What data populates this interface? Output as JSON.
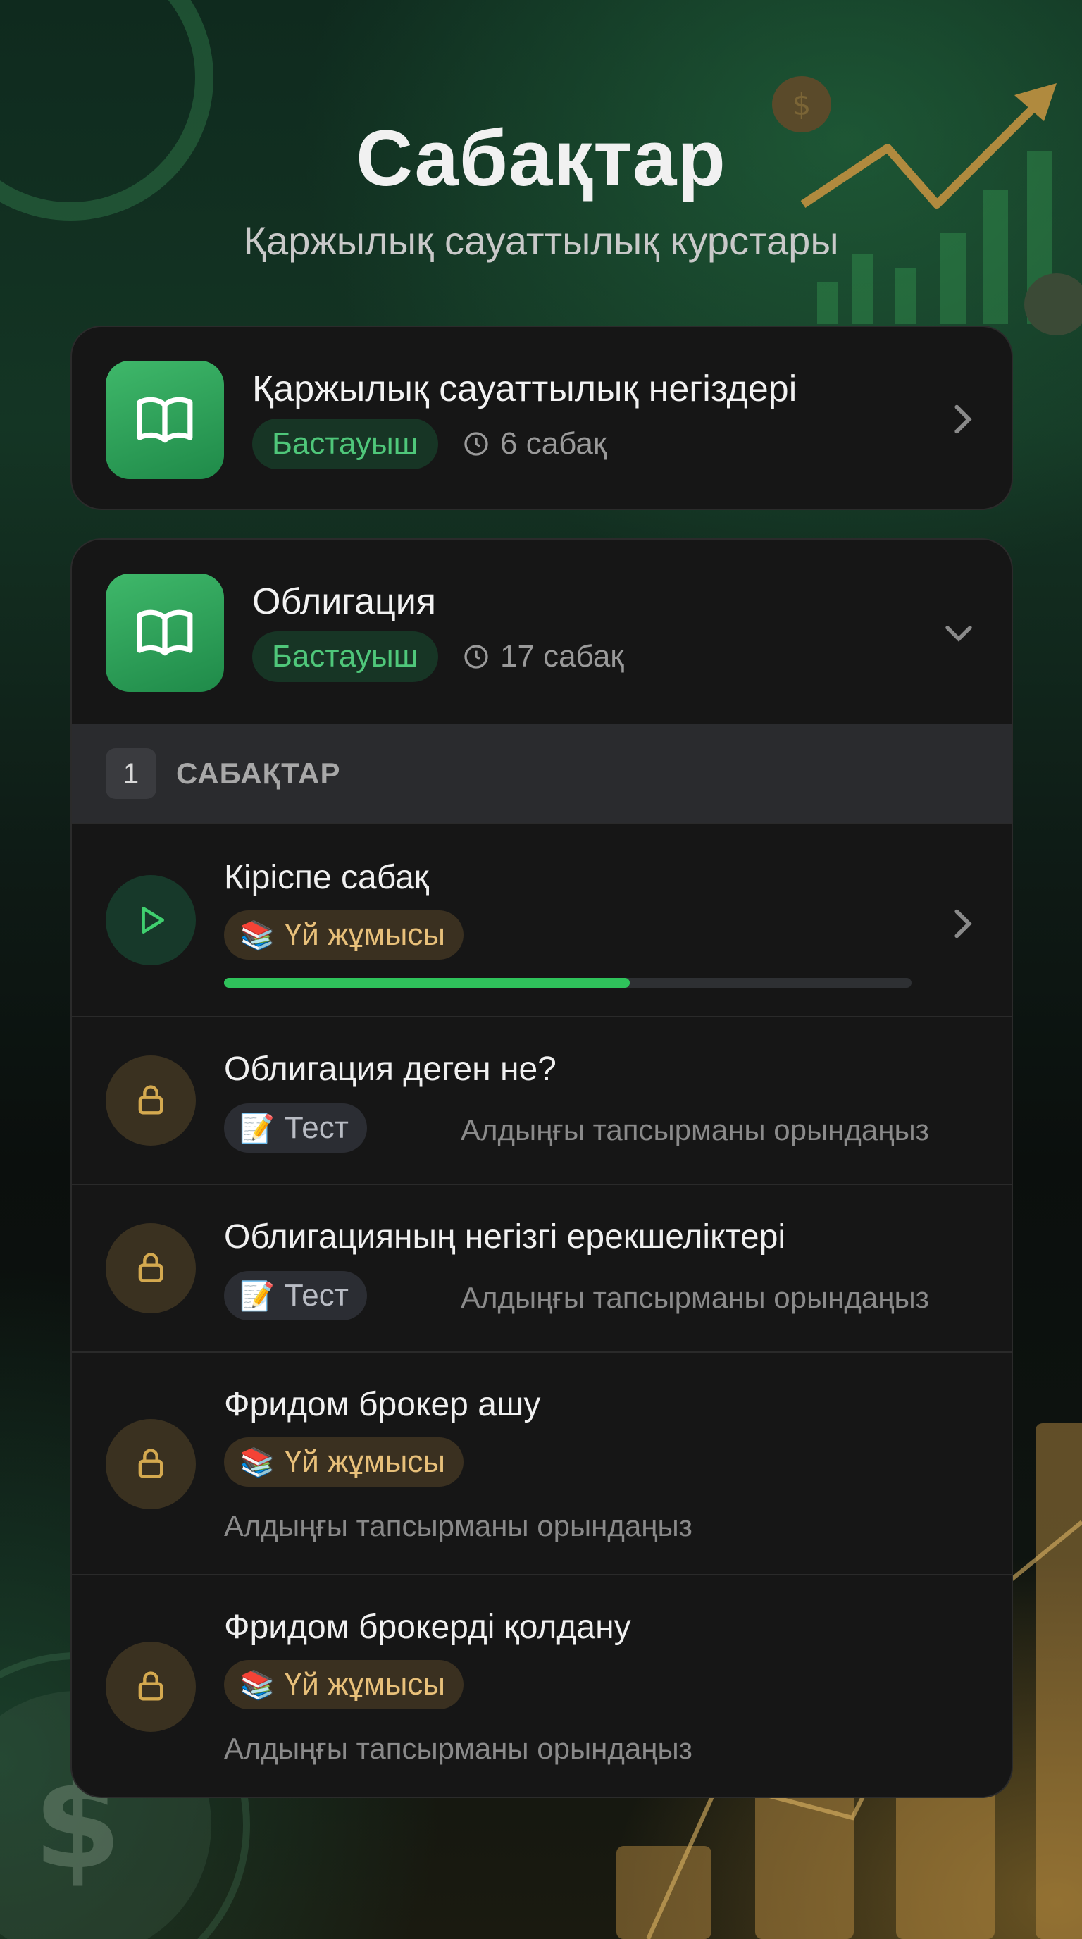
{
  "header": {
    "title": "Сабақтар",
    "subtitle": "Қаржылық сауаттылық курстары"
  },
  "courses": [
    {
      "title": "Қаржылық сауаттылық негіздері",
      "level": "Бастауыш",
      "lessons_count": "6 сабақ",
      "icon": "book-icon",
      "expanded": false
    },
    {
      "title": "Облигация",
      "level": "Бастауыш",
      "lessons_count": "17 сабақ",
      "icon": "book-icon",
      "expanded": true,
      "section": {
        "number": "1",
        "label": "САБАҚТАР"
      },
      "lessons": [
        {
          "title": "Кіріспе сабақ",
          "tag_emoji": "📚",
          "tag": "Үй жұмысы",
          "status": "active",
          "progress": 0.59,
          "icon": "play-icon"
        },
        {
          "title": "Облигация деген не?",
          "tag_emoji": "📝",
          "tag": "Тест",
          "hint": "Алдыңғы тапсырманы орындаңыз",
          "status": "locked",
          "icon": "lock-icon"
        },
        {
          "title": "Облигацияның негізгі ерекшеліктері",
          "tag_emoji": "📝",
          "tag": "Тест",
          "hint": "Алдыңғы тапсырманы орындаңыз",
          "status": "locked",
          "icon": "lock-icon"
        },
        {
          "title": "Фридом брокер ашу",
          "tag_emoji": "📚",
          "tag": "Үй жұмысы",
          "hint": "Алдыңғы тапсырманы орындаңыз",
          "status": "locked",
          "icon": "lock-icon"
        },
        {
          "title": "Фридом брокерді қолдану",
          "tag_emoji": "📚",
          "tag": "Үй жұмысы",
          "hint": "Алдыңғы тапсырманы орындаңыз",
          "status": "locked",
          "icon": "lock-icon"
        }
      ]
    }
  ],
  "colors": {
    "accent_green": "#2fc25b",
    "level_text": "#4fc77a",
    "homework_text": "#e8c07a",
    "background": "#0e1a15"
  }
}
